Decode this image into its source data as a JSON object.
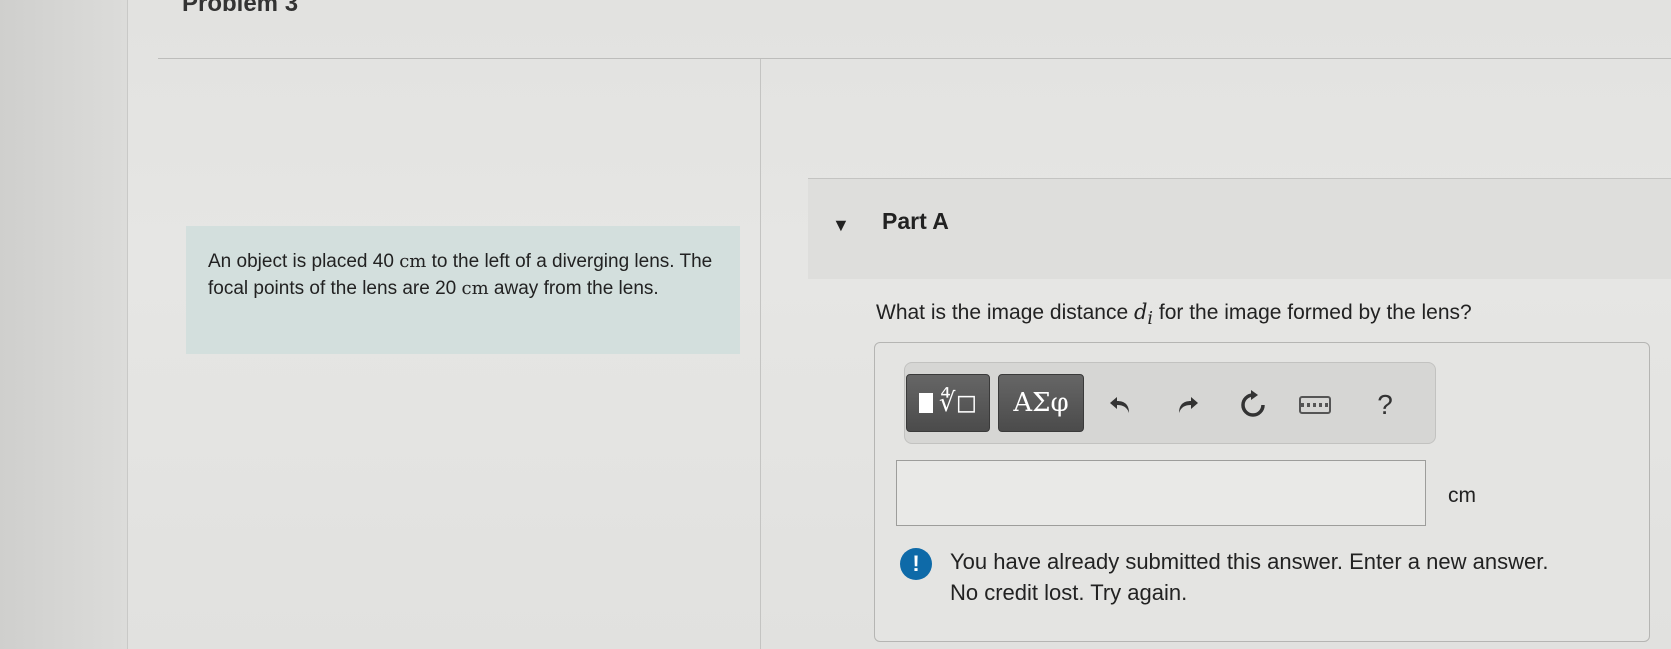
{
  "problem": {
    "title": "Problem 3",
    "statement_part1": "An object is placed 40 ",
    "unit1": "cm",
    "statement_part2": " to the left of a diverging lens. The focal points of the lens are 20 ",
    "unit2": "cm",
    "statement_part3": " away from the lens."
  },
  "part": {
    "label": "Part A",
    "question_before": "What is the image distance ",
    "variable": "d",
    "subscript": "i",
    "question_after": " for the image formed by the lens?"
  },
  "toolbar": {
    "greek_label": "ΑΣφ",
    "help_label": "?"
  },
  "answer": {
    "value": "",
    "unit": "cm"
  },
  "feedback": {
    "line1": "You have already submitted this answer. Enter a new answer.",
    "line2": "No credit lost. Try again.",
    "icon_glyph": "!",
    "icon_color": "#0e6aa8"
  }
}
